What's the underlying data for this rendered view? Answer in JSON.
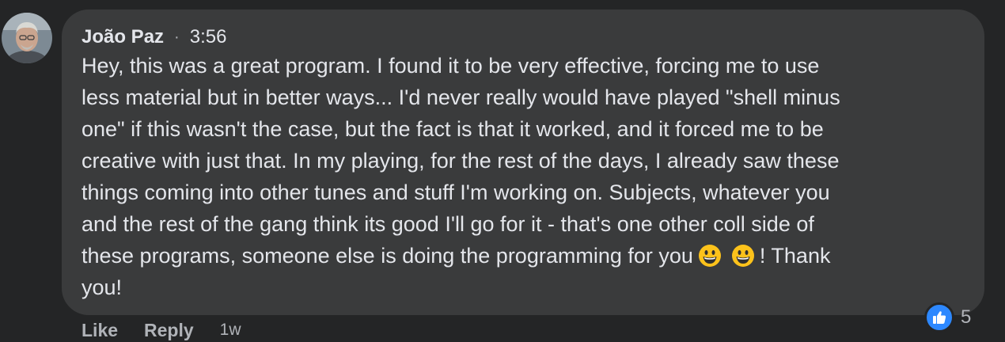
{
  "comment": {
    "author": "João Paz",
    "separator": "·",
    "time": "3:56",
    "text_before_emoji": "Hey, this was a great program. I found it to be very effective, forcing me to use\nless material but in better ways... I'd never really would have played \"shell minus\none\" if this wasn't the case, but the fact is that it worked, and it forced me to be\ncreative with just that. In my playing, for the rest of the days, I already saw these\nthings coming into other tunes and stuff I'm working on. Subjects, whatever you\nand the rest of the gang think its good I'll go for it - that's one other coll side of\nthese programs, someone else is doing the programming for you",
    "emojis": [
      "grinning-face",
      "grinning-face"
    ],
    "text_after_emoji": "! Thank\nyou!"
  },
  "reactions": {
    "icon": "like-thumbs-up-icon",
    "count": "5",
    "color": "#2d88ff"
  },
  "actions": {
    "like_label": "Like",
    "reply_label": "Reply",
    "age": "1w"
  }
}
